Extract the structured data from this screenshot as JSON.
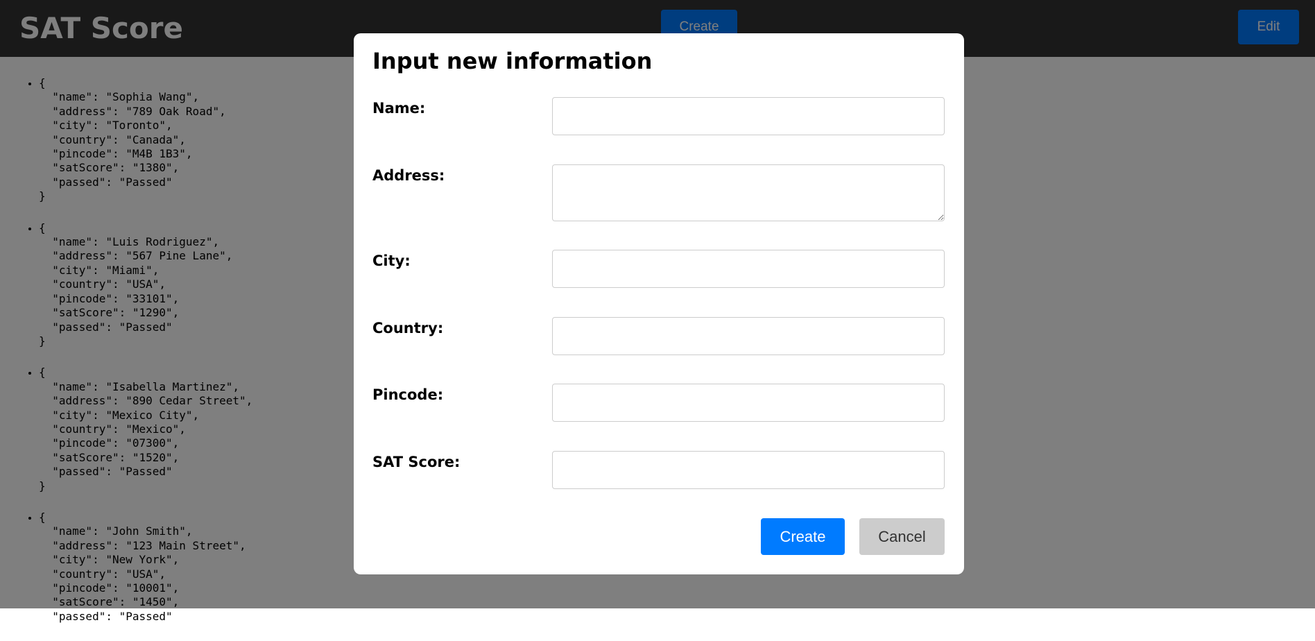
{
  "header": {
    "title": "SAT Score",
    "create_label": "Create",
    "edit_label": "Edit"
  },
  "records": [
    "{\n  \"name\": \"Sophia Wang\",\n  \"address\": \"789 Oak Road\",\n  \"city\": \"Toronto\",\n  \"country\": \"Canada\",\n  \"pincode\": \"M4B 1B3\",\n  \"satScore\": \"1380\",\n  \"passed\": \"Passed\"\n}",
    "{\n  \"name\": \"Luis Rodriguez\",\n  \"address\": \"567 Pine Lane\",\n  \"city\": \"Miami\",\n  \"country\": \"USA\",\n  \"pincode\": \"33101\",\n  \"satScore\": \"1290\",\n  \"passed\": \"Passed\"\n}",
    "{\n  \"name\": \"Isabella Martinez\",\n  \"address\": \"890 Cedar Street\",\n  \"city\": \"Mexico City\",\n  \"country\": \"Mexico\",\n  \"pincode\": \"07300\",\n  \"satScore\": \"1520\",\n  \"passed\": \"Passed\"\n}",
    "{\n  \"name\": \"John Smith\",\n  \"address\": \"123 Main Street\",\n  \"city\": \"New York\",\n  \"country\": \"USA\",\n  \"pincode\": \"10001\",\n  \"satScore\": \"1450\",\n  \"passed\": \"Passed\""
  ],
  "modal": {
    "title": "Input new information",
    "fields": [
      {
        "label": "Name:",
        "value": ""
      },
      {
        "label": "Address:",
        "value": ""
      },
      {
        "label": "City:",
        "value": ""
      },
      {
        "label": "Country:",
        "value": ""
      },
      {
        "label": "Pincode:",
        "value": ""
      },
      {
        "label": "SAT Score:",
        "value": ""
      }
    ],
    "create_label": "Create",
    "cancel_label": "Cancel"
  },
  "colors": {
    "header_bg": "#333333",
    "primary": "#007bff",
    "cancel_bg": "#cccccc",
    "overlay": "rgba(0,0,0,0.5)"
  }
}
